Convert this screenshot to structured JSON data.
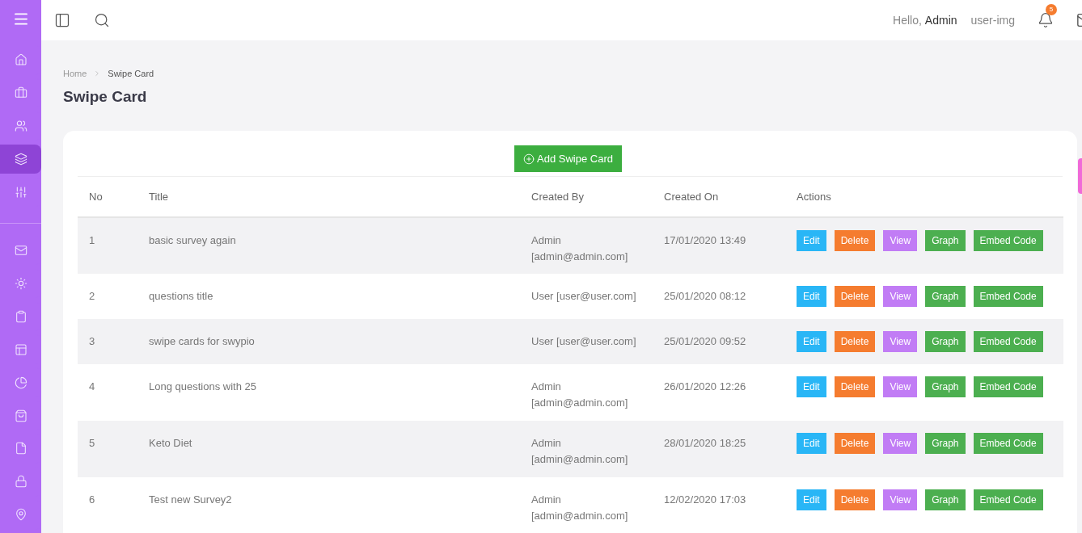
{
  "sidebar": {
    "groups": [
      [
        {
          "selected": false
        },
        {
          "selected": false
        },
        {
          "selected": false
        },
        {
          "selected": true
        },
        {
          "selected": false
        }
      ],
      [
        {
          "selected": false
        },
        {
          "selected": false
        },
        {
          "selected": false
        },
        {
          "selected": false
        },
        {
          "selected": false
        },
        {
          "selected": false
        },
        {
          "selected": false
        },
        {
          "selected": false
        },
        {
          "selected": false
        }
      ]
    ]
  },
  "topbar": {
    "greeting": "Hello,",
    "user_name": "Admin",
    "avatar_alt": "user-img",
    "notification_count": "5"
  },
  "breadcrumb": [
    "Home",
    "Swipe Card"
  ],
  "page_title": "Swipe Card",
  "add_button": "Add Swipe Card",
  "table": {
    "columns": [
      "No",
      "Title",
      "Created By",
      "Created On",
      "Actions"
    ],
    "rows": [
      {
        "no": "1",
        "title": "basic survey again",
        "created_by": "Admin [admin@admin.com]",
        "created_on": "17/01/2020 13:49",
        "actions": [
          {
            "kind": "edit",
            "label": "Edit"
          },
          {
            "kind": "delete",
            "label": "Delete"
          },
          {
            "kind": "view",
            "label": "View"
          },
          {
            "kind": "graph",
            "label": "Graph"
          },
          {
            "kind": "embed",
            "label": "Embed Code"
          }
        ]
      },
      {
        "no": "2",
        "title": "questions title",
        "created_by": "User [user@user.com]",
        "created_on": "25/01/2020 08:12",
        "actions": [
          {
            "kind": "edit",
            "label": "Edit"
          },
          {
            "kind": "delete",
            "label": "Delete"
          },
          {
            "kind": "view",
            "label": "View"
          },
          {
            "kind": "graph",
            "label": "Graph"
          },
          {
            "kind": "embed",
            "label": "Embed Code"
          }
        ]
      },
      {
        "no": "3",
        "title": "swipe cards for swypio",
        "created_by": "User [user@user.com]",
        "created_on": "25/01/2020 09:52",
        "actions": [
          {
            "kind": "edit",
            "label": "Edit"
          },
          {
            "kind": "delete",
            "label": "Delete"
          },
          {
            "kind": "view",
            "label": "View"
          },
          {
            "kind": "graph",
            "label": "Graph"
          },
          {
            "kind": "embed",
            "label": "Embed Code"
          }
        ]
      },
      {
        "no": "4",
        "title": "Long questions with 25",
        "created_by": "Admin [admin@admin.com]",
        "created_on": "26/01/2020 12:26",
        "actions": [
          {
            "kind": "edit",
            "label": "Edit"
          },
          {
            "kind": "delete",
            "label": "Delete"
          },
          {
            "kind": "view",
            "label": "View"
          },
          {
            "kind": "graph",
            "label": "Graph"
          },
          {
            "kind": "embed",
            "label": "Embed Code"
          }
        ]
      },
      {
        "no": "5",
        "title": "Keto Diet",
        "created_by": "Admin [admin@admin.com]",
        "created_on": "28/01/2020 18:25",
        "actions": [
          {
            "kind": "edit",
            "label": "Edit"
          },
          {
            "kind": "delete",
            "label": "Delete"
          },
          {
            "kind": "view",
            "label": "View"
          },
          {
            "kind": "graph",
            "label": "Graph"
          },
          {
            "kind": "embed",
            "label": "Embed Code"
          }
        ]
      },
      {
        "no": "6",
        "title": "Test new Survey2",
        "created_by": "Admin [admin@admin.com]",
        "created_on": "12/02/2020 17:03",
        "actions": [
          {
            "kind": "edit",
            "label": "Edit"
          },
          {
            "kind": "delete",
            "label": "Delete"
          },
          {
            "kind": "view",
            "label": "View"
          },
          {
            "kind": "graph",
            "label": "Graph"
          },
          {
            "kind": "embed",
            "label": "Embed Code"
          }
        ]
      }
    ]
  }
}
